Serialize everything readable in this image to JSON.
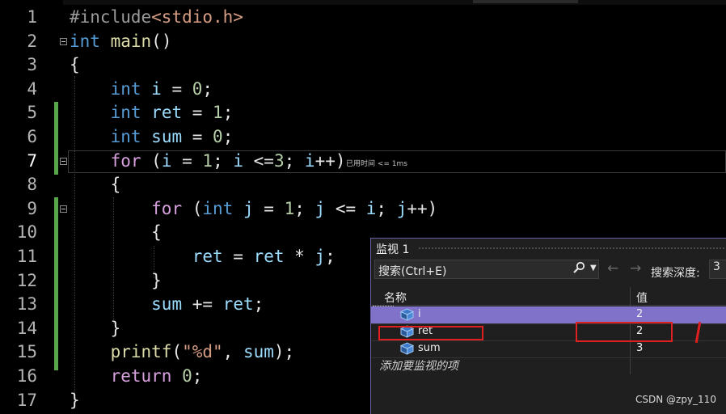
{
  "editor": {
    "lines": [
      {
        "num": "1",
        "tokens": [
          {
            "t": "#include",
            "c": "pp"
          },
          {
            "t": "<stdio.h>",
            "c": "hdr"
          }
        ]
      },
      {
        "num": "2",
        "tokens": [
          {
            "t": "int",
            "c": "kw"
          },
          {
            "t": " "
          },
          {
            "t": "main",
            "c": "fn"
          },
          {
            "t": "()"
          }
        ]
      },
      {
        "num": "3",
        "tokens": [
          {
            "t": "{"
          }
        ]
      },
      {
        "num": "4",
        "tokens": [
          {
            "t": "    "
          },
          {
            "t": "int",
            "c": "kw"
          },
          {
            "t": " "
          },
          {
            "t": "i",
            "c": "var"
          },
          {
            "t": " = "
          },
          {
            "t": "0",
            "c": "num"
          },
          {
            "t": ";"
          }
        ]
      },
      {
        "num": "5",
        "tokens": [
          {
            "t": "    "
          },
          {
            "t": "int",
            "c": "kw"
          },
          {
            "t": " "
          },
          {
            "t": "ret",
            "c": "var"
          },
          {
            "t": " = "
          },
          {
            "t": "1",
            "c": "num"
          },
          {
            "t": ";"
          }
        ]
      },
      {
        "num": "6",
        "tokens": [
          {
            "t": "    "
          },
          {
            "t": "int",
            "c": "kw"
          },
          {
            "t": " "
          },
          {
            "t": "sum",
            "c": "var"
          },
          {
            "t": " = "
          },
          {
            "t": "0",
            "c": "num"
          },
          {
            "t": ";"
          }
        ]
      },
      {
        "num": "7",
        "tokens": [
          {
            "t": "    "
          },
          {
            "t": "for",
            "c": "kw2"
          },
          {
            "t": " ("
          },
          {
            "t": "i",
            "c": "var"
          },
          {
            "t": " = "
          },
          {
            "t": "1",
            "c": "num"
          },
          {
            "t": "; "
          },
          {
            "t": "i",
            "c": "var"
          },
          {
            "t": " <="
          },
          {
            "t": "3",
            "c": "num"
          },
          {
            "t": "; "
          },
          {
            "t": "i",
            "c": "var"
          },
          {
            "t": "++)"
          }
        ]
      },
      {
        "num": "8",
        "tokens": [
          {
            "t": "    {"
          }
        ]
      },
      {
        "num": "9",
        "tokens": [
          {
            "t": "        "
          },
          {
            "t": "for",
            "c": "kw2"
          },
          {
            "t": " ("
          },
          {
            "t": "int",
            "c": "kw"
          },
          {
            "t": " "
          },
          {
            "t": "j",
            "c": "var"
          },
          {
            "t": " = "
          },
          {
            "t": "1",
            "c": "num"
          },
          {
            "t": "; "
          },
          {
            "t": "j",
            "c": "var"
          },
          {
            "t": " <= "
          },
          {
            "t": "i",
            "c": "var"
          },
          {
            "t": "; "
          },
          {
            "t": "j",
            "c": "var"
          },
          {
            "t": "++)"
          }
        ]
      },
      {
        "num": "10",
        "tokens": [
          {
            "t": "        {"
          }
        ]
      },
      {
        "num": "11",
        "tokens": [
          {
            "t": "            "
          },
          {
            "t": "ret",
            "c": "var"
          },
          {
            "t": " = "
          },
          {
            "t": "ret",
            "c": "var"
          },
          {
            "t": " * "
          },
          {
            "t": "j",
            "c": "var"
          },
          {
            "t": ";"
          }
        ]
      },
      {
        "num": "12",
        "tokens": [
          {
            "t": "        }"
          }
        ]
      },
      {
        "num": "13",
        "tokens": [
          {
            "t": "        "
          },
          {
            "t": "sum",
            "c": "var"
          },
          {
            "t": " += "
          },
          {
            "t": "ret",
            "c": "var"
          },
          {
            "t": ";"
          }
        ]
      },
      {
        "num": "14",
        "tokens": [
          {
            "t": "    }"
          }
        ]
      },
      {
        "num": "15",
        "tokens": [
          {
            "t": "    "
          },
          {
            "t": "printf",
            "c": "fn"
          },
          {
            "t": "("
          },
          {
            "t": "\"%d\"",
            "c": "str"
          },
          {
            "t": ", "
          },
          {
            "t": "sum",
            "c": "var"
          },
          {
            "t": ");"
          }
        ]
      },
      {
        "num": "16",
        "tokens": [
          {
            "t": "    "
          },
          {
            "t": "return",
            "c": "kw2"
          },
          {
            "t": " "
          },
          {
            "t": "0",
            "c": "num"
          },
          {
            "t": ";"
          }
        ]
      },
      {
        "num": "17",
        "tokens": [
          {
            "t": "}"
          }
        ]
      }
    ],
    "current_line": "7",
    "elapsed_hint": "已用时间 <= 1ms"
  },
  "watch": {
    "title": "监视 1",
    "search_placeholder": "搜索(Ctrl+E)",
    "search_icon": "search-icon",
    "back_icon": "←",
    "forward_icon": "→",
    "depth_label": "搜索深度:",
    "depth_value": "3",
    "col_name": "名称",
    "col_value": "值",
    "rows": [
      {
        "name": "i",
        "value": "2",
        "selected": true
      },
      {
        "name": "ret",
        "value": "2",
        "selected": false
      },
      {
        "name": "sum",
        "value": "3",
        "selected": false
      }
    ],
    "add_item": "添加要监视的项"
  },
  "watermark": "CSDN @zpy_110",
  "colors": {
    "background": "#000000",
    "keyword": "#569cd6",
    "control_keyword": "#d8a0df",
    "function": "#dcdcaa",
    "number": "#b5cea8",
    "string": "#d69d85",
    "selection": "#7f72c8",
    "annotation_red": "#e02020"
  }
}
